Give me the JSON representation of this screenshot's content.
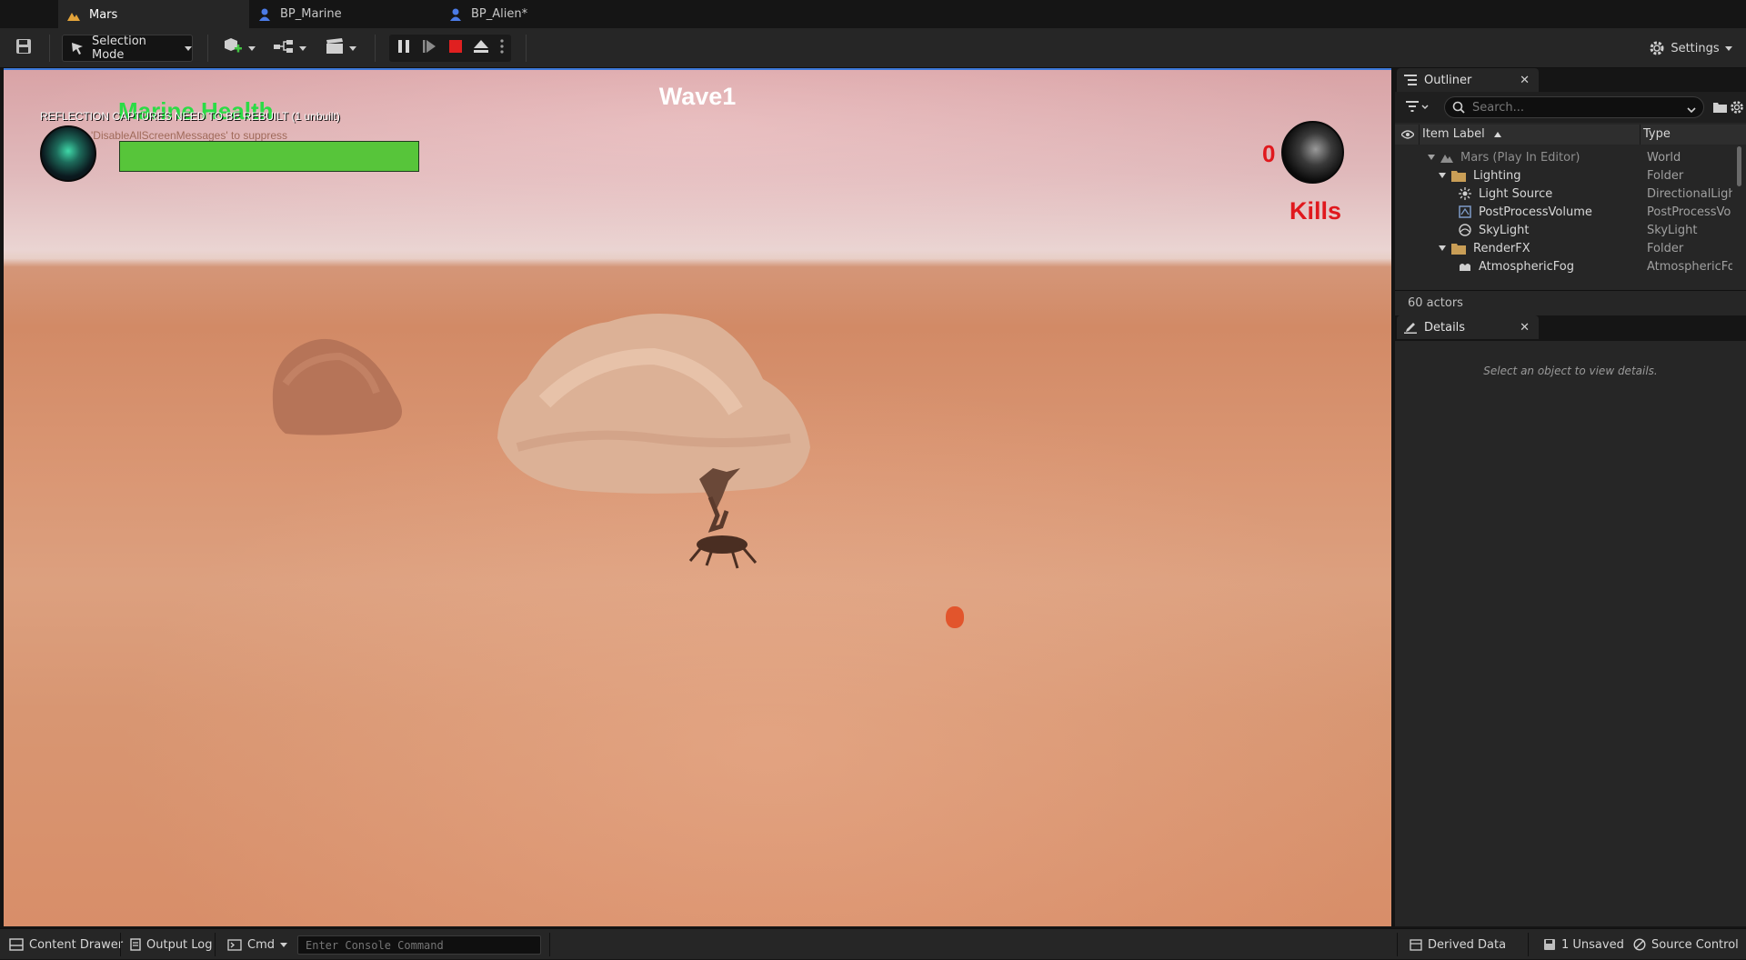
{
  "tabs": [
    {
      "label": "Mars",
      "icon": "level-icon",
      "active": true
    },
    {
      "label": "BP_Marine",
      "icon": "blueprint-icon",
      "active": false
    },
    {
      "label": "BP_Alien*",
      "icon": "blueprint-icon",
      "active": false
    }
  ],
  "toolbar": {
    "selection_mode": "Selection Mode",
    "settings": "Settings"
  },
  "hud": {
    "wave": "Wave1",
    "health_label": "Marine Health",
    "health_fraction": 1.0,
    "warning": "REFLECTION CAPTURES NEED TO BE REBUILT (1 unbuilt)",
    "suppress": "'DisableAllScreenMessages' to suppress",
    "kills_count": "0",
    "kills_label": "Kills"
  },
  "outliner": {
    "title": "Outliner",
    "search_placeholder": "Search...",
    "col_label": "Item Label",
    "col_type": "Type",
    "rows": [
      {
        "label": "Mars (Play In Editor)",
        "type": "World"
      },
      {
        "label": "Lighting",
        "type": "Folder"
      },
      {
        "label": "Light Source",
        "type": "DirectionalLight"
      },
      {
        "label": "PostProcessVolume",
        "type": "PostProcessVo"
      },
      {
        "label": "SkyLight",
        "type": "SkyLight"
      },
      {
        "label": "RenderFX",
        "type": "Folder"
      },
      {
        "label": "AtmosphericFog",
        "type": "AtmosphericFo"
      }
    ],
    "actors": "60 actors"
  },
  "details": {
    "title": "Details",
    "hint": "Select an object to view details."
  },
  "statusbar": {
    "content_drawer": "Content Drawer",
    "output_log": "Output Log",
    "cmd": "Cmd",
    "console_placeholder": "Enter Console Command",
    "derived_data": "Derived Data",
    "unsaved": "1 Unsaved",
    "source_control": "Source Control"
  },
  "colors": {
    "kills_red": "#e0181d",
    "health_green": "#57c53a",
    "accent_blue": "#3c78d8"
  }
}
